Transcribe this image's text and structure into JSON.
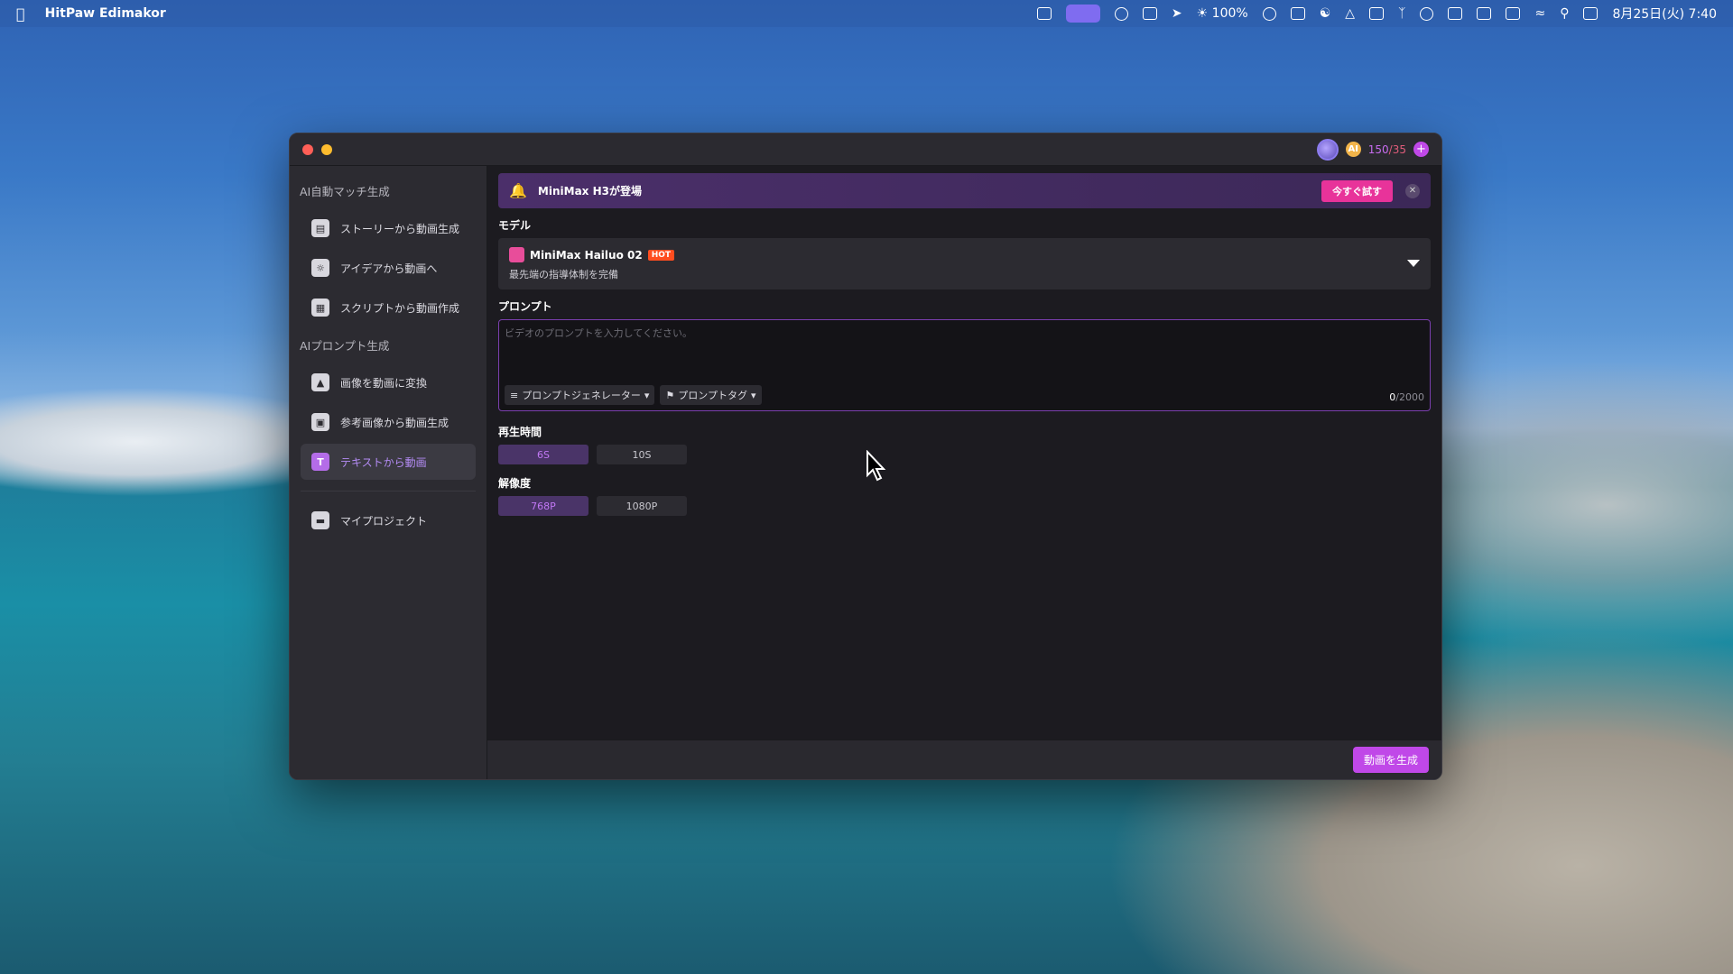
{
  "menubar": {
    "app_name": "HitPaw Edimakor",
    "battery": "100%",
    "datetime": "8月25日(火) 7:40"
  },
  "window": {
    "credits_used": "150",
    "credits_slash": "/",
    "credits_total": "35"
  },
  "sidebar": {
    "section1": "AI自動マッチ生成",
    "section2": "AIプロンプト生成",
    "items": [
      {
        "label": "ストーリーから動画生成",
        "icon": "document-icon"
      },
      {
        "label": "アイデアから動画へ",
        "icon": "lightbulb-icon"
      },
      {
        "label": "スクリプトから動画作成",
        "icon": "script-icon"
      },
      {
        "label": "画像を動画に変換",
        "icon": "image-icon"
      },
      {
        "label": "参考画像から動画生成",
        "icon": "reference-image-icon"
      },
      {
        "label": "テキストから動画",
        "icon": "text-icon"
      },
      {
        "label": "マイプロジェクト",
        "icon": "folder-icon"
      }
    ]
  },
  "banner": {
    "text": "MiniMax H3が登場",
    "try_button": "今すぐ試す"
  },
  "model": {
    "label": "モデル",
    "name": "MiniMax Hailuo 02",
    "badge": "HOT",
    "description": "最先端の指導体制を完備"
  },
  "prompt": {
    "label": "プロンプト",
    "placeholder": "ビデオのプロンプトを入力してください。",
    "generator_button": "プロンプトジェネレーター",
    "tag_button": "プロンプトタグ",
    "count": "0",
    "max": "/2000"
  },
  "duration": {
    "label": "再生時間",
    "options": [
      "6S",
      "10S"
    ],
    "selected": "6S"
  },
  "resolution": {
    "label": "解像度",
    "options": [
      "768P",
      "1080P"
    ],
    "selected": "768P"
  },
  "footer": {
    "generate_button": "動画を生成"
  },
  "colors": {
    "accent": "#c048e8",
    "banner_button": "#e8339a",
    "hot_badge": "#ff4d1f"
  }
}
